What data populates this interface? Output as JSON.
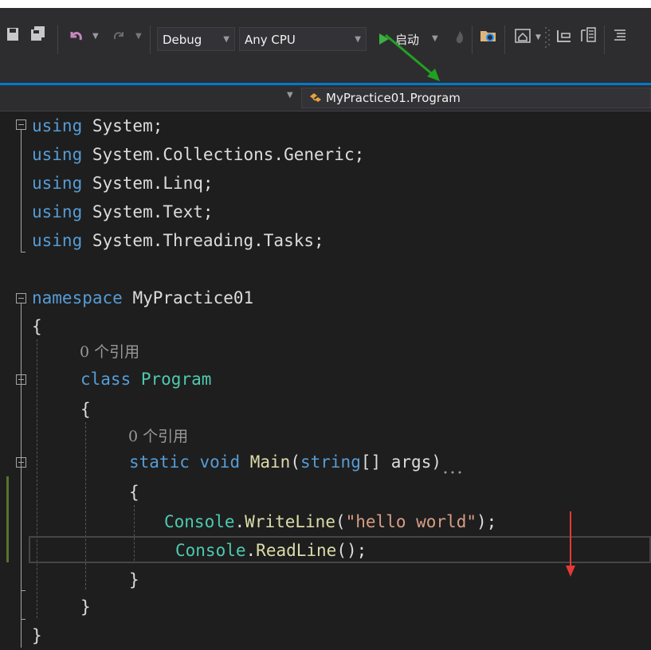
{
  "toolbar": {
    "config_combo": "Debug",
    "platform_combo": "Any CPU",
    "start_label": "启动"
  },
  "navbar": {
    "member": "MyPractice01.Program"
  },
  "code": {
    "line1": {
      "kw": "using",
      "rest": " System;"
    },
    "line2": {
      "kw": "using",
      "rest": " System.Collections.Generic;"
    },
    "line3": {
      "kw": "using",
      "rest": " System.Linq;"
    },
    "line4": {
      "kw": "using",
      "rest": " System.Text;"
    },
    "line5": {
      "kw": "using",
      "rest": " System.Threading.Tasks;"
    },
    "line7": {
      "kw": "namespace",
      "rest": " MyPractice01"
    },
    "line8": "{",
    "lens1": "0 个引用",
    "line10": {
      "kw": "class",
      "name": "Program"
    },
    "line11": "{",
    "lens2": "0 个引用",
    "line13": {
      "kw1": "static",
      "kw2": "void",
      "method": "Main",
      "open": "(",
      "type": "string",
      "rest": "[] args)"
    },
    "line14": "{",
    "line15": {
      "cls": "Console",
      "dot": ".",
      "method": "WriteLine",
      "open": "(",
      "str": "\"hello world\"",
      "close": ");"
    },
    "line16": {
      "cls": "Console",
      "dot": ".",
      "method": "ReadLine",
      "close": "();"
    },
    "line17": "}",
    "line18": "}",
    "line19": "}"
  }
}
